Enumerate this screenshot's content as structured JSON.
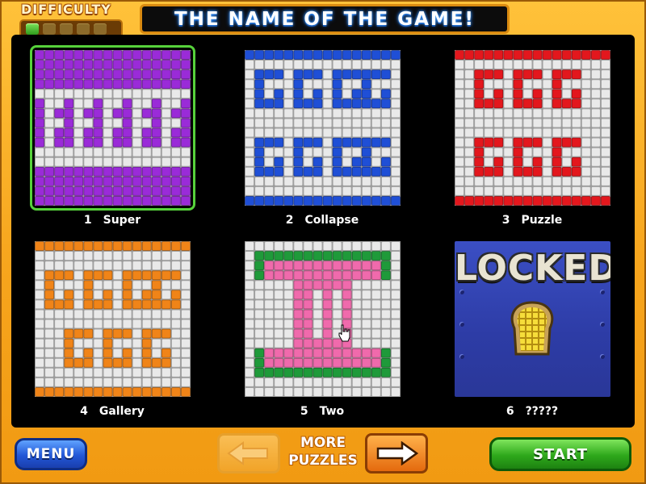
{
  "header": {
    "difficulty_label": "DIFFICULTY",
    "difficulty_level": 1,
    "difficulty_max": 5,
    "title": "THE NAME OF THE GAME!"
  },
  "puzzles": [
    {
      "number": "1",
      "name": "Super",
      "color": "#9a2bd8",
      "selected": true,
      "locked": false
    },
    {
      "number": "2",
      "name": "Collapse",
      "color": "#1f4fd6",
      "selected": false,
      "locked": false
    },
    {
      "number": "3",
      "name": "Puzzle",
      "color": "#e3171d",
      "selected": false,
      "locked": false
    },
    {
      "number": "4",
      "name": "Gallery",
      "color": "#f08418",
      "selected": false,
      "locked": false
    },
    {
      "number": "5",
      "name": "Two",
      "color": "#f06aac",
      "secondary_color": "#1f9a3a",
      "selected": false,
      "locked": false
    },
    {
      "number": "6",
      "name": "?????",
      "locked": true,
      "locked_text": "LOCKED",
      "color": "#3b4fc4"
    }
  ],
  "footer": {
    "menu_label": "MENU",
    "more_line1": "MORE",
    "more_line2": "PUZZLES",
    "start_label": "START"
  },
  "colors": {
    "background": "#f7a51d",
    "board": "#000000",
    "selected_outline": "#57d23b",
    "empty_cell": "#e9e9e9"
  }
}
